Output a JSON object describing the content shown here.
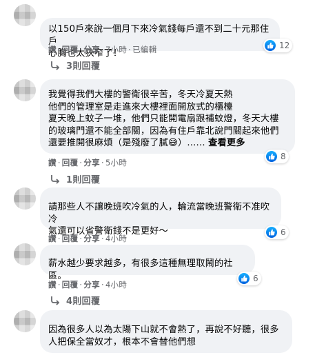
{
  "comments": [
    {
      "text": "以150戶來說一個月下來冷氣錢每戶還不到二十元那住戶\n心胸也太狹窄了！",
      "reactions": "12",
      "actions": {
        "like": "讚",
        "reply": "回覆",
        "share": "分享",
        "time": "7小時",
        "edited": "已編輯"
      },
      "replies": "3則回覆"
    },
    {
      "text": "我覺得我們大樓的警衛很辛苦，冬天冷夏天熱\n他們的管理室是走進來大樓裡面開放式的櫃檯\n夏天晚上蚊子一堆，他們只能開電扇跟補蚊燈，冬天大樓\n的玻璃門還不能全部關，因為有住戶靠北說門關起來他們\n還要推開很麻煩（是殘廢了膩😅）......",
      "see_more": "查看更多",
      "reactions": "8",
      "actions": {
        "like": "讚",
        "reply": "回覆",
        "share": "分享",
        "time": "5小時"
      },
      "replies": "1則回覆"
    },
    {
      "text": "請那些人不讓晚班吹冷氣的人，輪流當晚班警衛不准吹冷\n氣還可以省警衛錢不是更好～",
      "reactions": "6",
      "actions": {
        "like": "讚",
        "reply": "回覆",
        "share": "分享",
        "time": "4小時"
      }
    },
    {
      "text": "薪水越少要求越多，有很多這種無理取鬧的社區。",
      "reactions": "6",
      "actions": {
        "like": "讚",
        "reply": "回覆",
        "share": "分享",
        "time": "4小時"
      },
      "replies": "4則回覆"
    },
    {
      "text": "因為很多人以為太陽下山就不會熱了，再說不好聽，很多\n人把保全當奴才，根本不會替他們想"
    }
  ]
}
